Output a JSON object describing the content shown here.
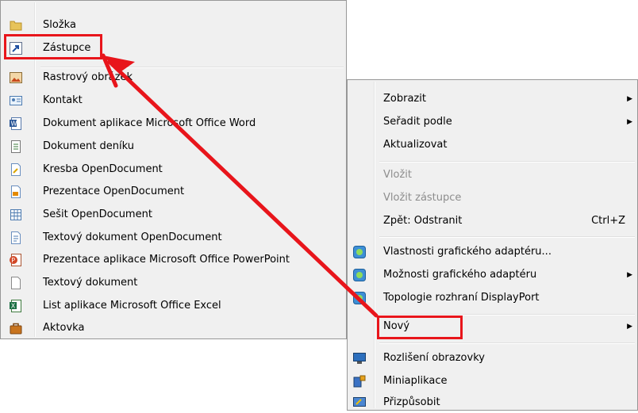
{
  "new_submenu": {
    "items": [
      {
        "label": "Složka",
        "icon": "folder-icon"
      },
      {
        "label": "Zástupce",
        "icon": "shortcut-icon"
      },
      {
        "label": "Rastrový obrázek",
        "icon": "bitmap-image-icon"
      },
      {
        "label": "Kontakt",
        "icon": "contact-card-icon"
      },
      {
        "label": "Dokument aplikace Microsoft Office Word",
        "icon": "word-document-icon"
      },
      {
        "label": "Dokument deníku",
        "icon": "journal-document-icon"
      },
      {
        "label": "Kresba OpenDocument",
        "icon": "opendocument-drawing-icon"
      },
      {
        "label": "Prezentace OpenDocument",
        "icon": "opendocument-presentation-icon"
      },
      {
        "label": "Sešit OpenDocument",
        "icon": "opendocument-spreadsheet-icon"
      },
      {
        "label": "Textový dokument OpenDocument",
        "icon": "opendocument-text-icon"
      },
      {
        "label": "Prezentace aplikace Microsoft Office PowerPoint",
        "icon": "powerpoint-icon"
      },
      {
        "label": "Textový dokument",
        "icon": "text-document-icon"
      },
      {
        "label": "List aplikace Microsoft Office Excel",
        "icon": "excel-icon"
      },
      {
        "label": "Aktovka",
        "icon": "briefcase-icon"
      }
    ]
  },
  "context_menu": {
    "items": [
      {
        "label": "Zobrazit",
        "submenu": true
      },
      {
        "label": "Seřadit podle",
        "submenu": true
      },
      {
        "label": "Aktualizovat"
      },
      {
        "label": "Vložit",
        "disabled": true
      },
      {
        "label": "Vložit zástupce",
        "disabled": true
      },
      {
        "label": "Zpět: Odstranit",
        "shortcut": "Ctrl+Z"
      },
      {
        "label": "Vlastnosti grafického adaptéru...",
        "icon": "graphics-adapter-icon"
      },
      {
        "label": "Možnosti grafického adaptéru",
        "icon": "graphics-adapter-icon",
        "submenu": true
      },
      {
        "label": "Topologie rozhraní DisplayPort",
        "icon": "graphics-adapter-icon"
      },
      {
        "label": "Nový",
        "submenu": true
      },
      {
        "label": "Rozlišení obrazovky",
        "icon": "monitor-icon"
      },
      {
        "label": "Miniaplikace",
        "icon": "gadgets-icon"
      },
      {
        "label": "Přizpůsobit",
        "icon": "personalize-icon"
      }
    ]
  },
  "annotation": {
    "color": "#e8151b",
    "highlighted": [
      "Zástupce",
      "Nový"
    ]
  },
  "colors": {
    "menu_bg": "#f0f0f0",
    "disabled_text": "#8d8d8d"
  }
}
